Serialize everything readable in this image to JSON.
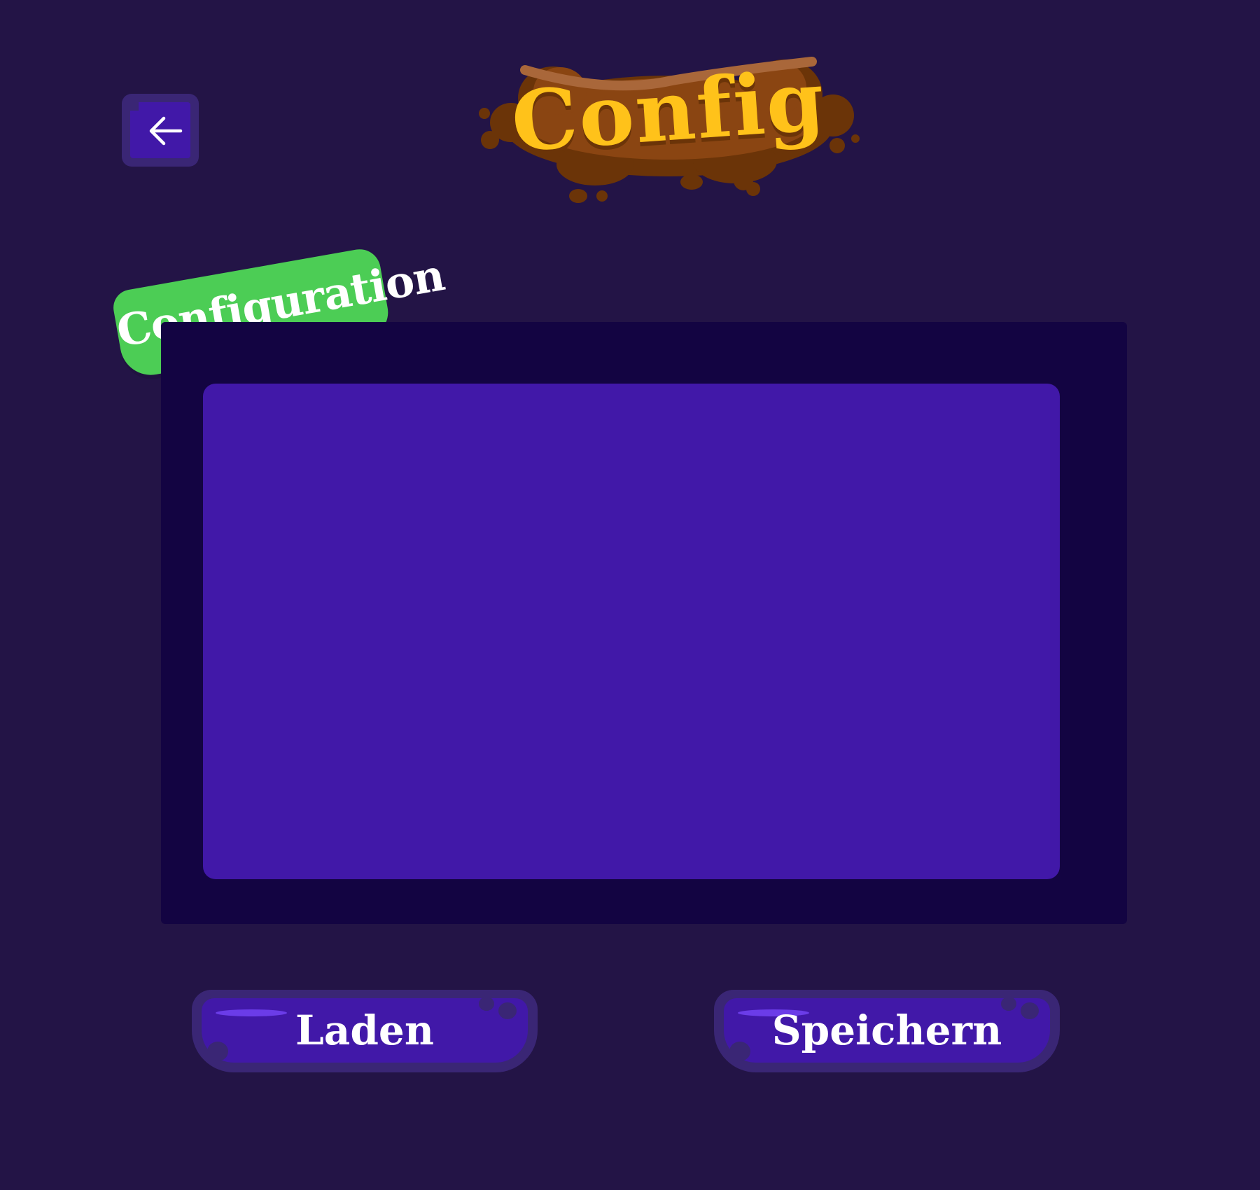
{
  "header": {
    "title": "Config"
  },
  "back_button": {
    "icon": "arrow-left-icon"
  },
  "section": {
    "tag_label": "Configuration"
  },
  "actions": {
    "load_label": "Laden",
    "save_label": "Speichern"
  },
  "colors": {
    "background": "#231446",
    "panel": "#130442",
    "content": "#4118a8",
    "tag": "#4ccd55",
    "title": "#ffc21a",
    "button_frame": "#3a2675"
  }
}
